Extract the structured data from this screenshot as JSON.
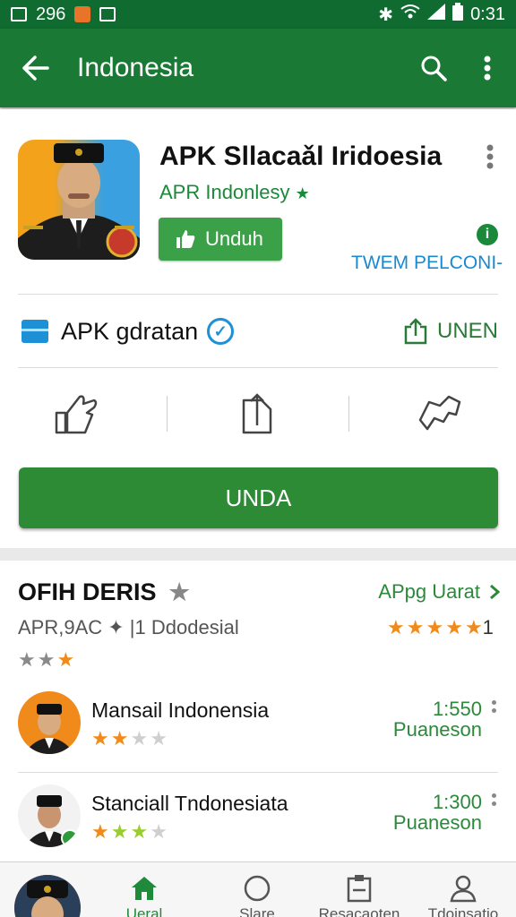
{
  "status_bar": {
    "notif_count": "296",
    "time": "0:31"
  },
  "toolbar": {
    "title": "Indonesia"
  },
  "app": {
    "title": "APK Sllacaǎl Iridoesia",
    "developer": "APR Indonlesy",
    "install_label": "Unduh",
    "link_text": "TWEM PELCONI-"
  },
  "verified_row": {
    "label": "APK gdratan",
    "share_label": "UNEN"
  },
  "main_button": {
    "label": "UNDA"
  },
  "section": {
    "title": "OFIH DERIS",
    "link": "APpg Uarat",
    "subinfo": "APR,9AC ✦ |1 Ddodesial",
    "rating_value": "1"
  },
  "list": [
    {
      "name": "Mansail Indonensia",
      "count": "1:550",
      "count_label": "Puaneson"
    },
    {
      "name": "Stanciall Tndonesiata",
      "count": "1:300",
      "count_label": "Puaneson"
    }
  ],
  "bottom_nav": [
    {
      "label": "Ueral"
    },
    {
      "label": "Slare"
    },
    {
      "label": "Resacaoten"
    },
    {
      "label": "Tdoinsatio"
    }
  ],
  "colors": {
    "primary": "#1a7a35",
    "accent": "#2e8b35",
    "link_blue": "#1a8ad0",
    "star_orange": "#f08a1a"
  }
}
